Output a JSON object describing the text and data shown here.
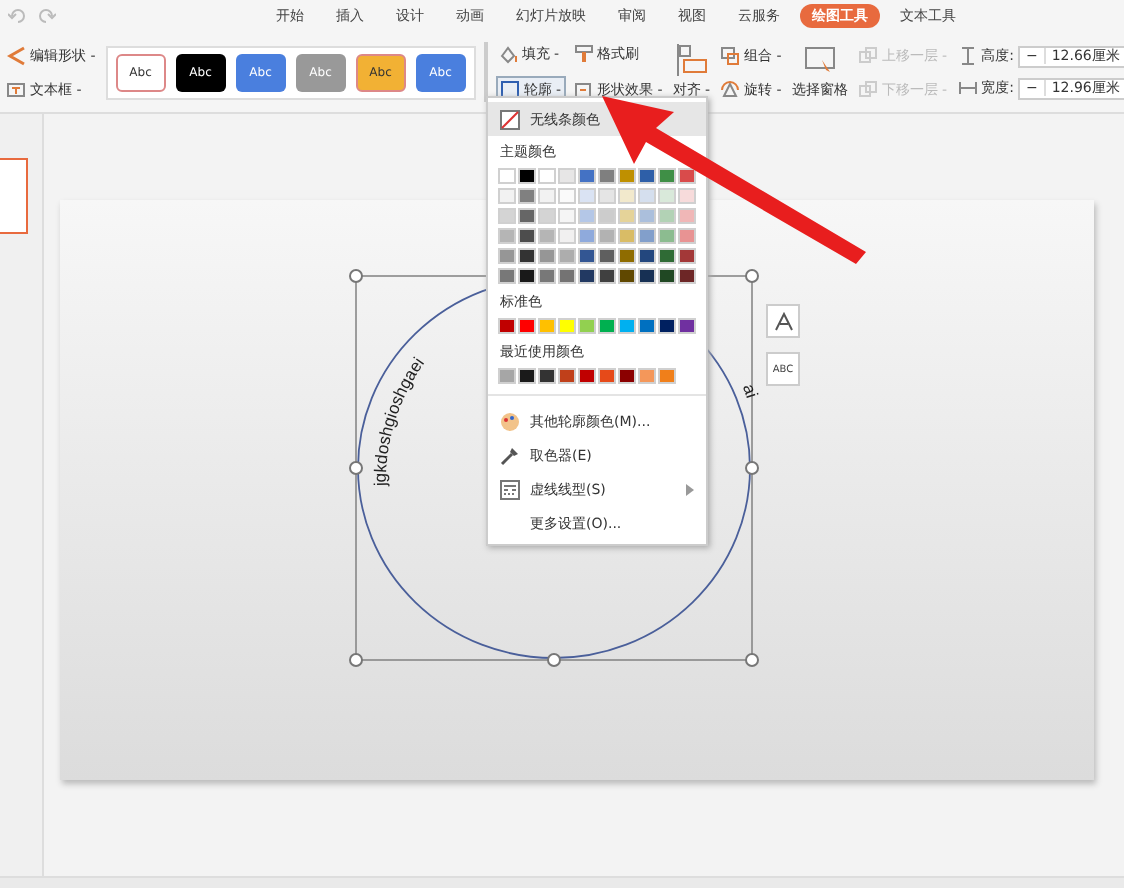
{
  "ribbon_tabs": [
    {
      "label": "开始",
      "selected": false
    },
    {
      "label": "插入",
      "selected": false
    },
    {
      "label": "设计",
      "selected": false
    },
    {
      "label": "动画",
      "selected": false
    },
    {
      "label": "幻灯片放映",
      "selected": false
    },
    {
      "label": "审阅",
      "selected": false
    },
    {
      "label": "视图",
      "selected": false
    },
    {
      "label": "云服务",
      "selected": false
    },
    {
      "label": "绘图工具",
      "selected": true
    },
    {
      "label": "文本工具",
      "selected": false
    }
  ],
  "shape_tools": [
    {
      "label": "编辑形状 -"
    },
    {
      "label": "文本框 -"
    }
  ],
  "style_gallery": [
    {
      "label": "Abc",
      "color": "#ffffff"
    },
    {
      "label": "Abc",
      "color": "#000000"
    },
    {
      "label": "Abc",
      "color": "#4a7fde"
    },
    {
      "label": "Abc",
      "color": "#999999"
    },
    {
      "label": "Abc",
      "color": "#f2b134"
    },
    {
      "label": "Abc",
      "color": "#4a7fde"
    }
  ],
  "format_buttons": [
    {
      "label": "填充 -",
      "selected": false
    },
    {
      "label": "格式刷",
      "selected": false
    },
    {
      "label": "轮廓 -",
      "selected": true
    },
    {
      "label": "形状效果 -",
      "selected": false
    }
  ],
  "align_button": {
    "label": "对齐 -"
  },
  "arrange_buttons": [
    {
      "label": "组合 -",
      "disabled": false
    },
    {
      "label": "旋转 -",
      "disabled": false
    }
  ],
  "selection_pane": {
    "label": "选择窗格"
  },
  "layer_buttons": [
    {
      "label": "上移一层 -",
      "disabled": true
    },
    {
      "label": "下移一层 -",
      "disabled": true
    }
  ],
  "size_fields": [
    {
      "label": "高度:",
      "decrease": "−",
      "value": "12.66厘米"
    },
    {
      "label": "宽度:",
      "decrease": "−",
      "value": "12.96厘米"
    }
  ],
  "slide_panel": {
    "thumbnails": [
      {
        "selected": true
      }
    ]
  },
  "shape": {
    "text_left": "jgkdoshgioshgaei",
    "text_right": "ai"
  },
  "float_buttons": [
    {
      "kind": "icon"
    },
    {
      "kind": "text",
      "label": "ABC"
    }
  ],
  "outline_menu": {
    "no_line": {
      "label": "无线条颜色",
      "selected": true
    },
    "theme_heading": "主题颜色",
    "theme_colors": [
      {
        "color": "#ffffff"
      },
      {
        "color": "#000000"
      },
      {
        "color": "#ffffff"
      },
      {
        "color": "#e7e6e6"
      },
      {
        "color": "#4472c4"
      },
      {
        "color": "#7f7f7f"
      },
      {
        "color": "#bf9000"
      },
      {
        "color": "#2e5fa8"
      },
      {
        "color": "#3f8f46"
      },
      {
        "color": "#d94b4b"
      }
    ],
    "standard_heading": "标准色",
    "standard_colors": [
      {
        "color": "#c00000"
      },
      {
        "color": "#ff0000"
      },
      {
        "color": "#ffc000"
      },
      {
        "color": "#ffff00"
      },
      {
        "color": "#92d050"
      },
      {
        "color": "#00b050"
      },
      {
        "color": "#00b0f0"
      },
      {
        "color": "#0070c0"
      },
      {
        "color": "#002060"
      },
      {
        "color": "#7030a0"
      }
    ],
    "recent_heading": "最近使用颜色",
    "recent_colors": [
      {
        "color": "#a6a6a6"
      },
      {
        "color": "#1a1a1a"
      },
      {
        "color": "#333333"
      },
      {
        "color": "#c0401a"
      },
      {
        "color": "#c00000"
      },
      {
        "color": "#e64a19"
      },
      {
        "color": "#8b0000"
      },
      {
        "color": "#f4975a"
      },
      {
        "color": "#f07f1a"
      }
    ],
    "items": [
      {
        "kind": "palette",
        "label": "其他轮廓颜色(M)..."
      },
      {
        "kind": "picker",
        "label": "取色器(E)"
      },
      {
        "kind": "dash",
        "label": "虚线线型(S)",
        "submenu": true
      },
      {
        "kind": "plain",
        "label": "更多设置(O)..."
      }
    ]
  }
}
